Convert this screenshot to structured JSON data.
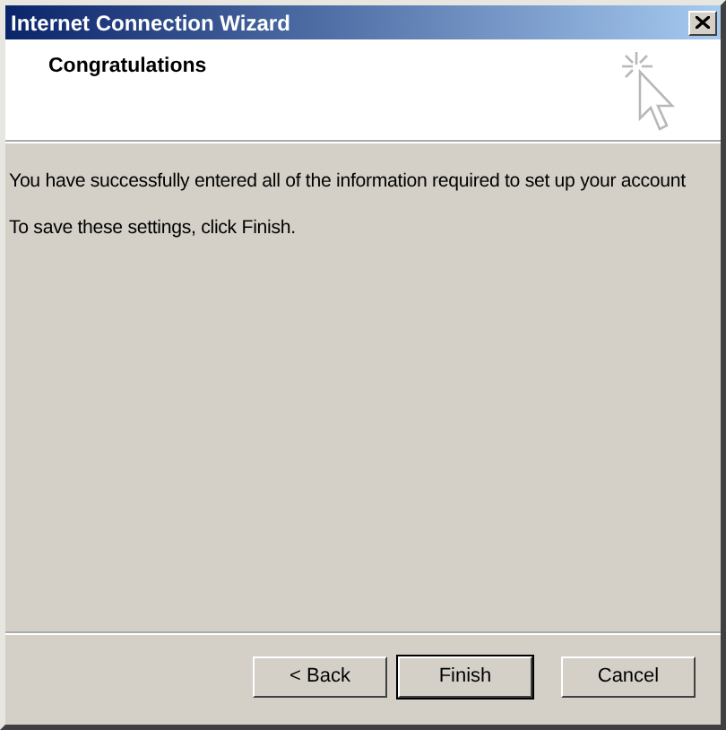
{
  "window": {
    "title": "Internet Connection Wizard"
  },
  "header": {
    "title": "Congratulations"
  },
  "body": {
    "paragraphs": [
      "You have successfully entered all of the information required to set up your account",
      "To save these settings, click Finish."
    ]
  },
  "buttons": [
    {
      "label": "< Back",
      "default": false
    },
    {
      "label": "Finish",
      "default": true
    },
    {
      "label": "Cancel",
      "default": false
    }
  ]
}
